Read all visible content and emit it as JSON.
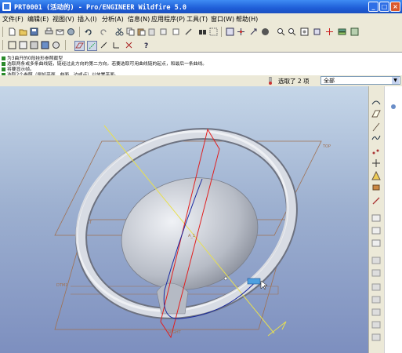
{
  "window": {
    "title": "PRT0001 (活动的) - Pro/ENGINEER Wildfire 5.0",
    "controls": [
      "_",
      "□",
      "×"
    ]
  },
  "menu": [
    "文件(F)",
    "编辑(E)",
    "视图(V)",
    "插入(I)",
    "分析(A)",
    "信息(N)",
    "应用程序(P)",
    "工具(T)",
    "窗口(W)",
    "帮助(H)"
  ],
  "messages": [
    "为3曲开的0段挂形参照截型",
    "选取两条或多条曲线链，链经过此方向的第二方向。若要选取可用曲线链的起点，和最后一条曲线。",
    "将要显示帧。",
    "选取2个参照（例如平面、曲面、边或点）以放置平面。"
  ],
  "status": {
    "selected_text": "选取了 2 项",
    "filter_value": "全部"
  },
  "viewport": {
    "datum_top": "TOP",
    "datum_front": "FRONT",
    "datum_dtm": "DTM1",
    "datum_right": "RIGHT",
    "axis_label": "A_1"
  },
  "colors": {
    "title_bar": "#1f5ed8",
    "background_top": "#c5d6e8",
    "background_bottom": "#7d8fbf",
    "datum_plane": "#a07050",
    "highlight": "#e02020"
  }
}
